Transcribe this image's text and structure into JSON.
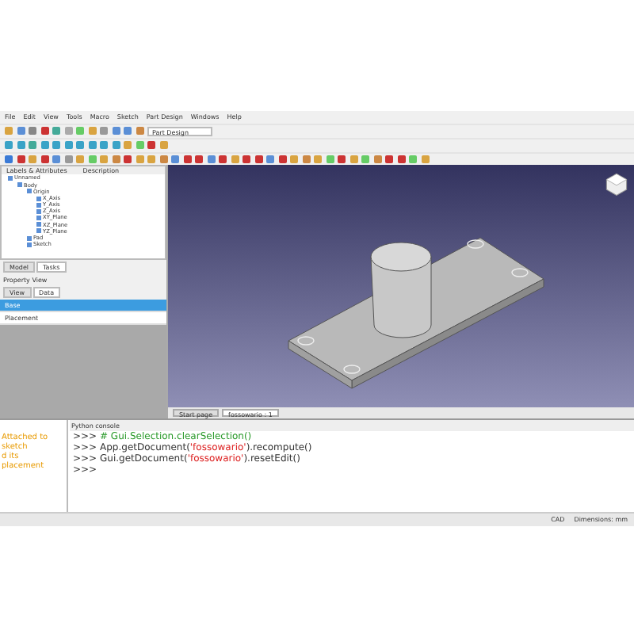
{
  "menu": [
    "File",
    "Edit",
    "View",
    "Tools",
    "Macro",
    "Sketch",
    "Part Design",
    "Windows",
    "Help"
  ],
  "toolbar": {
    "workbench": "Part Design"
  },
  "tree": {
    "columns": [
      "Labels & Attributes",
      "Description"
    ],
    "items": [
      {
        "label": "Unnamed",
        "children": [
          {
            "label": "Body",
            "children": [
              {
                "label": "Origin",
                "children": [
                  {
                    "label": "X_Axis"
                  },
                  {
                    "label": "Y_Axis"
                  },
                  {
                    "label": "Z_Axis"
                  },
                  {
                    "label": "XY_Plane"
                  },
                  {
                    "label": "XZ_Plane"
                  },
                  {
                    "label": "YZ_Plane"
                  }
                ]
              },
              {
                "label": "Pad"
              },
              {
                "label": "Sketch"
              }
            ]
          }
        ]
      }
    ]
  },
  "panel_tabs": [
    {
      "label": "Model",
      "selected": false
    },
    {
      "label": "Tasks",
      "selected": true
    }
  ],
  "property_title": "Property View",
  "property_tabs": [
    {
      "label": "View",
      "selected": false
    },
    {
      "label": "Data",
      "selected": true
    }
  ],
  "property_rows": [
    {
      "label": "Base",
      "selected": true
    },
    {
      "label": "Placement",
      "selected": false
    }
  ],
  "view_tabs": [
    {
      "label": "Start page",
      "selected": false
    },
    {
      "label": "fossowario : 1",
      "selected": true
    }
  ],
  "report": {
    "lines": [
      "Attached to",
      "sketch",
      "d its",
      "placement"
    ]
  },
  "console": {
    "title": "Python console",
    "lines": [
      {
        "prompt": ">>>",
        "parts": [
          {
            "kind": "comment",
            "text": "# Gui.Selection.clearSelection()"
          }
        ]
      },
      {
        "prompt": ">>>",
        "parts": [
          {
            "kind": "code",
            "text": "App.getDocument("
          },
          {
            "kind": "string",
            "text": "'fossowario'"
          },
          {
            "kind": "code",
            "text": ").recompute()"
          }
        ]
      },
      {
        "prompt": ">>>",
        "parts": [
          {
            "kind": "code",
            "text": "Gui.getDocument("
          },
          {
            "kind": "string",
            "text": "'fossowario'"
          },
          {
            "kind": "code",
            "text": ").resetEdit()"
          }
        ]
      },
      {
        "prompt": ">>>"
      }
    ]
  },
  "status_bar": [
    "CAD",
    "Dimensions: mm"
  ]
}
